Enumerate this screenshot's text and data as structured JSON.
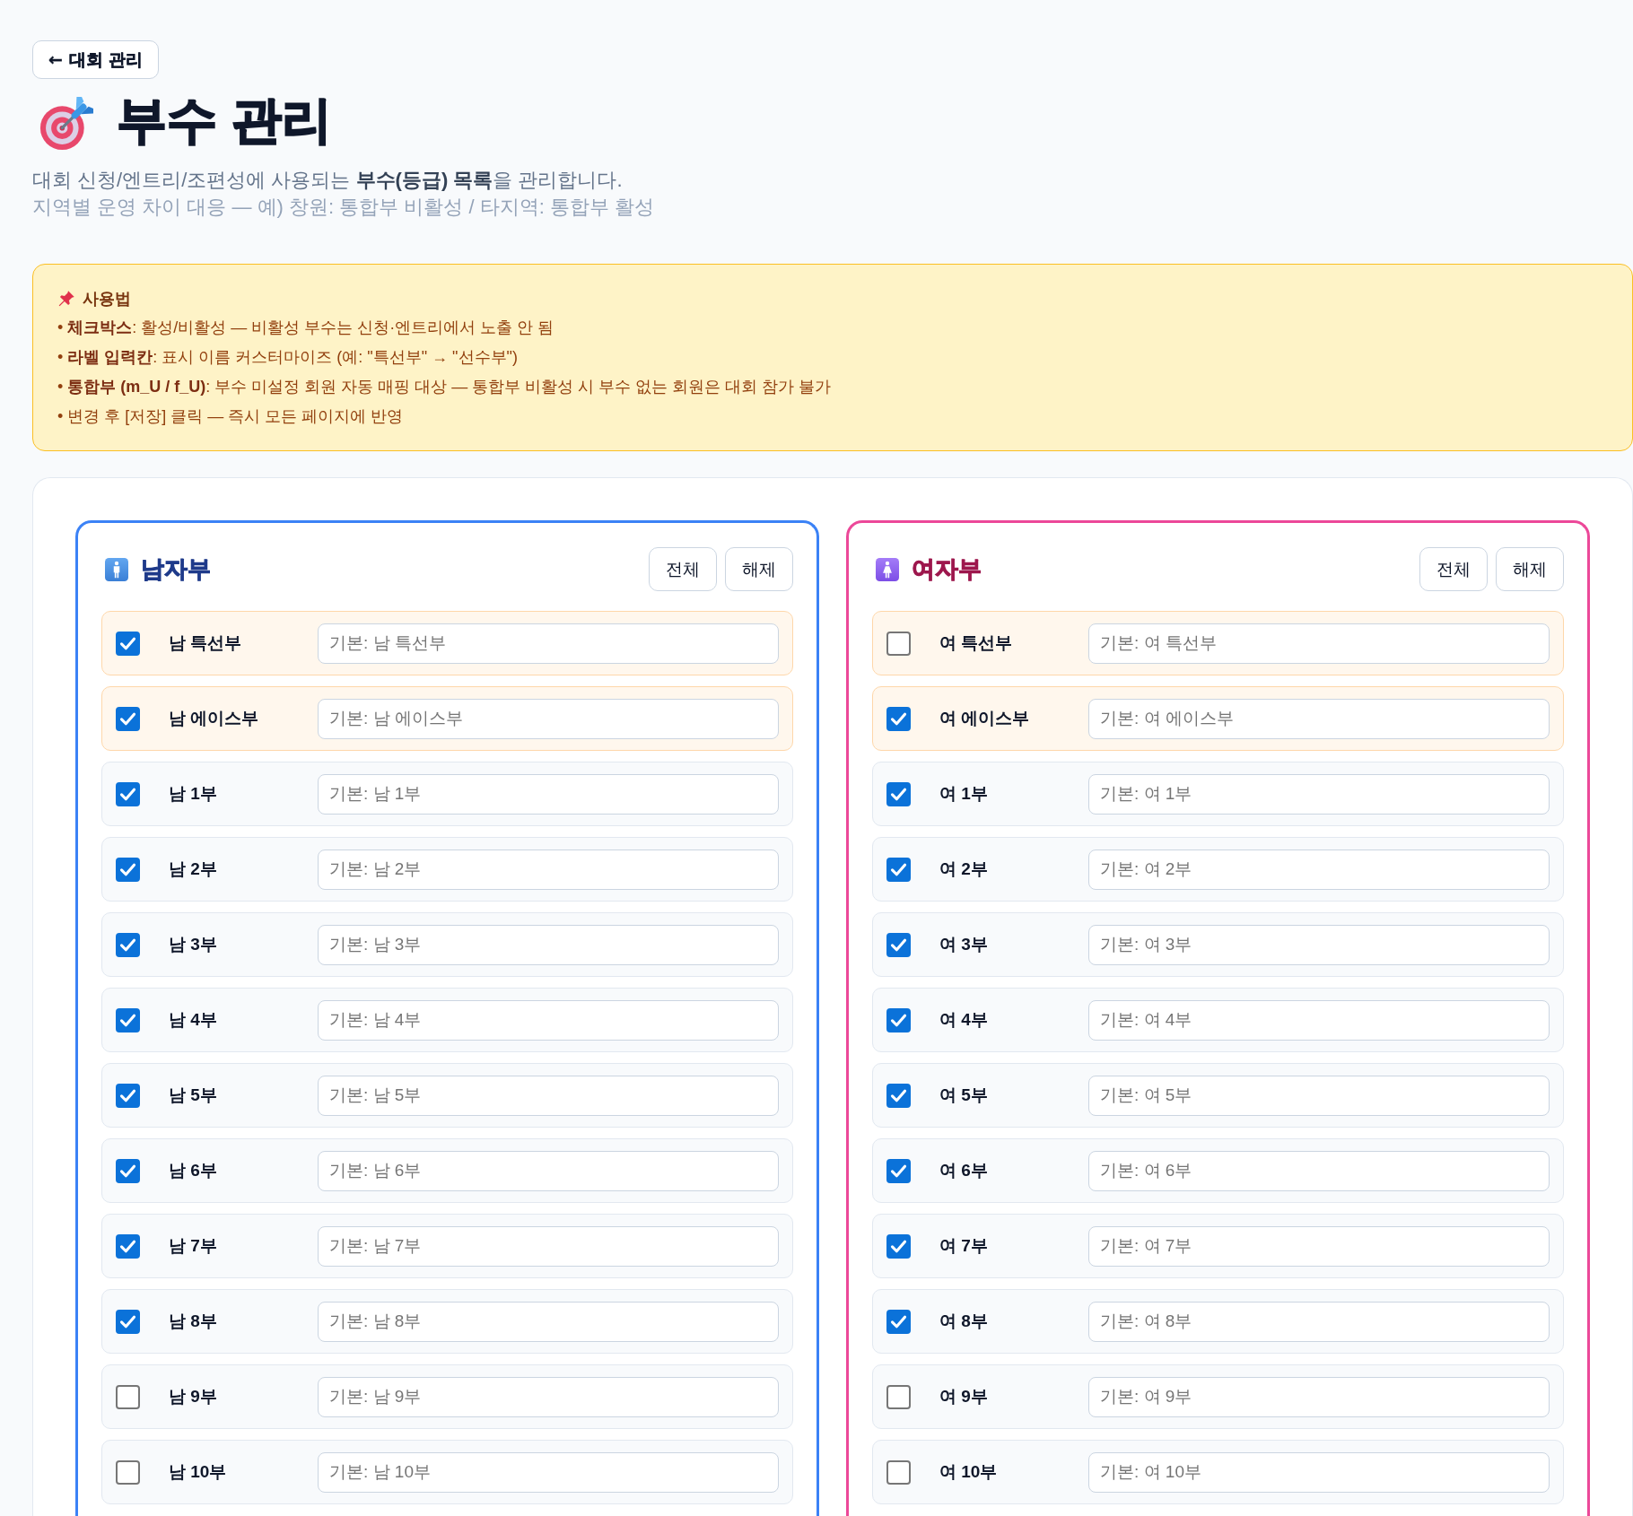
{
  "back_button": {
    "label": "← 대회 관리"
  },
  "header": {
    "title": "부수 관리",
    "description": "대회 신청/엔트리/조편성에 사용되는 **부수(등급) 목록**을 관리합니다.",
    "note": "지역별 운영 차이 대응 — 예) 창원: 통합부 비활성 / 타지역: 통합부 활성"
  },
  "usage": {
    "title": "사용법",
    "items": [
      "• **체크박스**: 활성/비활성 — 비활성 부수는 신청·엔트리에서 노출 안 됨",
      "• **라벨 입력칸**: 표시 이름 커스터마이즈 (예: \"특선부\" → \"선수부\")",
      "• **통합부 (m_U / f_U)**: 부수 미설정 회원 자동 매핑 대상 — 통합부 비활성 시 부수 없는 회원은 대회 참가 불가",
      "• 변경 후 [저장] 클릭 — 즉시 모든 페이지에 반영"
    ]
  },
  "panels": [
    {
      "kind": "male",
      "title": "남자부",
      "buttons": [
        "전체",
        "해제"
      ],
      "divisions": [
        {
          "label": "남 특선부",
          "checked": true,
          "highlighted": true,
          "placeholder": "기본: 남 특선부"
        },
        {
          "label": "남 에이스부",
          "checked": true,
          "highlighted": true,
          "placeholder": "기본: 남 에이스부"
        },
        {
          "label": "남 1부",
          "checked": true,
          "highlighted": false,
          "placeholder": "기본: 남 1부"
        },
        {
          "label": "남 2부",
          "checked": true,
          "highlighted": false,
          "placeholder": "기본: 남 2부"
        },
        {
          "label": "남 3부",
          "checked": true,
          "highlighted": false,
          "placeholder": "기본: 남 3부"
        },
        {
          "label": "남 4부",
          "checked": true,
          "highlighted": false,
          "placeholder": "기본: 남 4부"
        },
        {
          "label": "남 5부",
          "checked": true,
          "highlighted": false,
          "placeholder": "기본: 남 5부"
        },
        {
          "label": "남 6부",
          "checked": true,
          "highlighted": false,
          "placeholder": "기본: 남 6부"
        },
        {
          "label": "남 7부",
          "checked": true,
          "highlighted": false,
          "placeholder": "기본: 남 7부"
        },
        {
          "label": "남 8부",
          "checked": true,
          "highlighted": false,
          "placeholder": "기본: 남 8부"
        },
        {
          "label": "남 9부",
          "checked": false,
          "highlighted": false,
          "placeholder": "기본: 남 9부"
        },
        {
          "label": "남 10부",
          "checked": false,
          "highlighted": false,
          "placeholder": "기본: 남 10부"
        }
      ]
    },
    {
      "kind": "female",
      "title": "여자부",
      "buttons": [
        "전체",
        "해제"
      ],
      "divisions": [
        {
          "label": "여 특선부",
          "checked": false,
          "highlighted": true,
          "placeholder": "기본: 여 특선부"
        },
        {
          "label": "여 에이스부",
          "checked": true,
          "highlighted": true,
          "placeholder": "기본: 여 에이스부"
        },
        {
          "label": "여 1부",
          "checked": true,
          "highlighted": false,
          "placeholder": "기본: 여 1부"
        },
        {
          "label": "여 2부",
          "checked": true,
          "highlighted": false,
          "placeholder": "기본: 여 2부"
        },
        {
          "label": "여 3부",
          "checked": true,
          "highlighted": false,
          "placeholder": "기본: 여 3부"
        },
        {
          "label": "여 4부",
          "checked": true,
          "highlighted": false,
          "placeholder": "기본: 여 4부"
        },
        {
          "label": "여 5부",
          "checked": true,
          "highlighted": false,
          "placeholder": "기본: 여 5부"
        },
        {
          "label": "여 6부",
          "checked": true,
          "highlighted": false,
          "placeholder": "기본: 여 6부"
        },
        {
          "label": "여 7부",
          "checked": true,
          "highlighted": false,
          "placeholder": "기본: 여 7부"
        },
        {
          "label": "여 8부",
          "checked": true,
          "highlighted": false,
          "placeholder": "기본: 여 8부"
        },
        {
          "label": "여 9부",
          "checked": false,
          "highlighted": false,
          "placeholder": "기본: 여 9부"
        },
        {
          "label": "여 10부",
          "checked": false,
          "highlighted": false,
          "placeholder": "기본: 여 10부"
        }
      ]
    }
  ]
}
